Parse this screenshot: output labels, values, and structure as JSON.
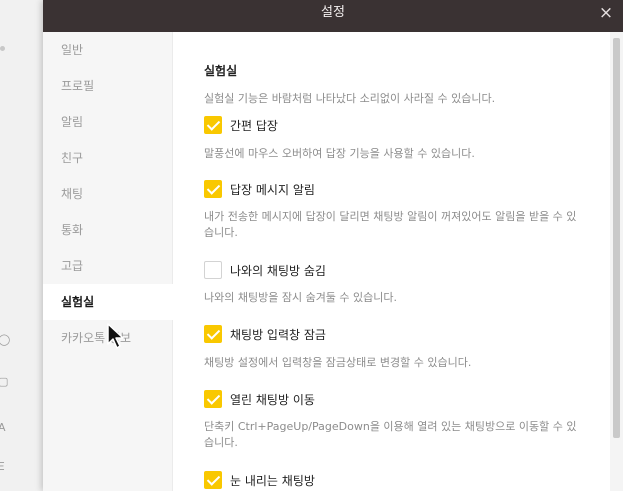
{
  "window": {
    "title": "설정",
    "close_glyph": "×"
  },
  "sidebar": {
    "items": [
      {
        "label": "일반"
      },
      {
        "label": "프로필"
      },
      {
        "label": "알림"
      },
      {
        "label": "친구"
      },
      {
        "label": "채팅"
      },
      {
        "label": "통화"
      },
      {
        "label": "고급"
      },
      {
        "label": "실험실",
        "active": true
      },
      {
        "label": "카카오톡 정보"
      }
    ]
  },
  "lab": {
    "title": "실험실",
    "description": "실험실 기능은 바람처럼 나타났다 소리없이 사라질 수 있습니다.",
    "options": [
      {
        "label": "간편 답장",
        "checked": true,
        "description": "말풍선에 마우스 오버하여 답장 기능을 사용할 수 있습니다."
      },
      {
        "label": "답장 메시지 알림",
        "checked": true,
        "description": "내가 전송한 메시지에 답장이 달리면 채팅방 알림이 꺼져있어도 알림을 받을 수 있습니다."
      },
      {
        "label": "나와의 채팅방 숨김",
        "checked": false,
        "description": "나와의 채팅방을 잠시 숨겨둘 수 있습니다."
      },
      {
        "label": "채팅방 입력창 잠금",
        "checked": true,
        "description": "채팅방 설정에서 입력창을 잠금상태로 변경할 수 있습니다."
      },
      {
        "label": "열린 채팅방 이동",
        "checked": true,
        "description": "단축키 Ctrl+PageUp/PageDown을 이용해 열려 있는 채팅방으로 이동할 수 있습니다."
      },
      {
        "label": "눈 내리는 채팅방",
        "checked": true,
        "description": ""
      }
    ]
  },
  "background": {
    "glyphs": [
      "◯",
      "▢",
      "A",
      "Ξ"
    ]
  },
  "colors": {
    "titlebar": "#3a3233",
    "checkbox_on": "#f9c800",
    "sidebar_bg": "#f6f6f6"
  }
}
